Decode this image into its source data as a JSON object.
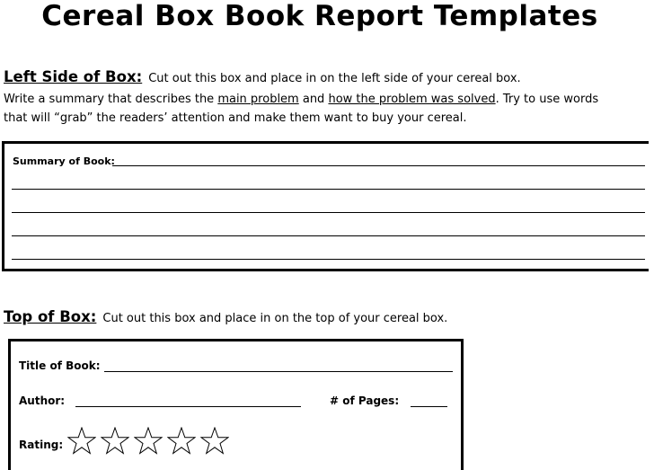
{
  "document": {
    "title": "Cereal Box Book Report Templates"
  },
  "left_side": {
    "heading": "Left Side of Box:",
    "instruction": "Cut out this box and place in on the left side of your cereal box.",
    "p_write": "Write a summary that describes the ",
    "p_main_problem": "main problem",
    "p_and": " and ",
    "p_how_solved": "how the problem was solved",
    "p_try": ".  Try to use words",
    "p_line3": "that will “grab” the readers’ attention and make them want to buy your cereal.",
    "summary_label": "Summary of Book:"
  },
  "top_side": {
    "heading": "Top of Box:",
    "instruction": "Cut out this box and place in on the top of your cereal box.",
    "title_label": "Title of Book:",
    "author_label": "Author:",
    "pages_label": "# of Pages:",
    "rating_label": "Rating:",
    "rating_star_count": 5
  }
}
